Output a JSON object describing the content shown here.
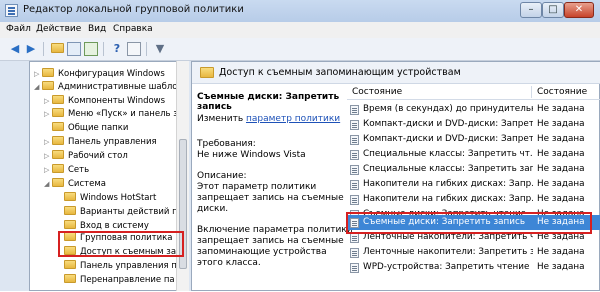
{
  "window": {
    "title": "Редактор локальной групповой политики"
  },
  "title_buttons": {
    "minimize": "–",
    "maximize": "□",
    "close": "✕"
  },
  "menu": [
    "Файл",
    "Действие",
    "Вид",
    "Справка"
  ],
  "toolbar": {
    "icons": [
      "back-icon",
      "forward-icon",
      "up-folder-icon",
      "show-tree-icon",
      "export-icon",
      "help-icon",
      "properties-icon",
      "filter-icon"
    ]
  },
  "tree": {
    "items": [
      {
        "label": "Конфигурация Windows",
        "expanded": false
      },
      {
        "label": "Административные шаблоны",
        "expanded": true
      },
      {
        "label": "Компоненты Windows",
        "expanded": false
      },
      {
        "label": "Меню «Пуск» и панель за",
        "expanded": false
      },
      {
        "label": "Общие папки",
        "expanded": false
      },
      {
        "label": "Панель управления",
        "expanded": false
      },
      {
        "label": "Рабочий стол",
        "expanded": false
      },
      {
        "label": "Сеть",
        "expanded": false
      },
      {
        "label": "Система",
        "expanded": true
      },
      {
        "label": "Windows HotStart",
        "expanded": false
      },
      {
        "label": "Варианты действий по",
        "expanded": false
      },
      {
        "label": "Вход в систему",
        "expanded": false
      },
      {
        "label": "Групповая политика",
        "expanded": false
      },
      {
        "label": "Доступ к съемным за",
        "expanded": false,
        "selected": true
      },
      {
        "label": "Панель управления п",
        "expanded": false
      },
      {
        "label": "Перенаправление па",
        "expanded": false
      }
    ]
  },
  "right_header": {
    "title": "Доступ к съемным запоминающим устройствам"
  },
  "description": {
    "title": "Съемные диски: Запретить запись",
    "change_prefix": "Изменить",
    "change_link": "параметр политики",
    "req_label": "Требования:",
    "req_value": "Не ниже Windows Vista",
    "desc_label": "Описание:",
    "desc_lines": [
      "Этот параметр политики",
      "запрещает запись на съемные",
      "диски."
    ],
    "enable_lines": [
      "Включение параметра политики",
      "запрещает запись на съемные",
      "запоминающие устройства",
      "этого класса."
    ]
  },
  "list": {
    "col_state": "Состояние",
    "col_status": "Состояние",
    "rows": [
      {
        "name": "Время (в секундах) до принудительн...",
        "status": "Не задана"
      },
      {
        "name": "Компакт-диски и DVD-диски: Запрет...",
        "status": "Не задана"
      },
      {
        "name": "Компакт-диски и DVD-диски: Запрет...",
        "status": "Не задана"
      },
      {
        "name": "Специальные классы: Запретить чт...",
        "status": "Не задана"
      },
      {
        "name": "Специальные классы: Запретить зап...",
        "status": "Не задана"
      },
      {
        "name": "Накопители на гибких дисках: Запр...",
        "status": "Не задана"
      },
      {
        "name": "Накопители на гибких дисках: Запр...",
        "status": "Не задана"
      },
      {
        "name": "Съемные диски: Запретить чтение",
        "status": "Не задана"
      },
      {
        "name": "Съемные диски: Запретить запись",
        "status": "Не задана",
        "selected": true
      },
      {
        "name": "Ленточные накопители: Запретить ч...",
        "status": "Не задана"
      },
      {
        "name": "Ленточные накопители: Запретить з...",
        "status": "Не задана"
      },
      {
        "name": "WPD-устройства: Запретить чтение",
        "status": "Не задана"
      }
    ]
  },
  "colors": {
    "accent": "#3d86d6",
    "highlight_box": "#d62020",
    "link": "#1e52b8"
  }
}
